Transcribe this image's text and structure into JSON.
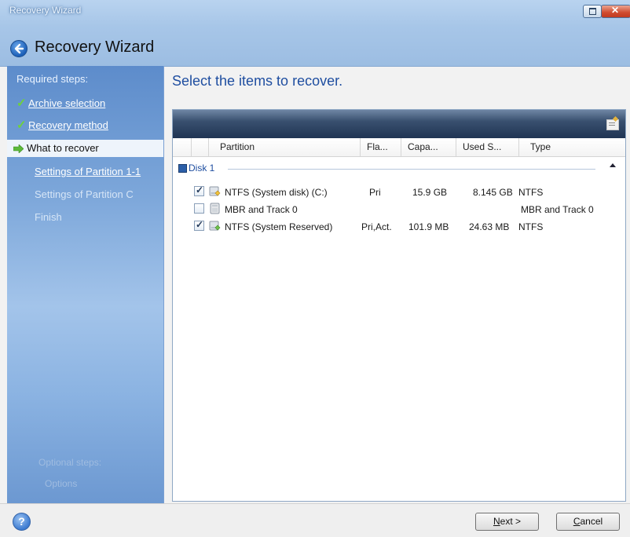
{
  "window": {
    "title": "Recovery Wizard",
    "header_title": "Recovery Wizard",
    "accent": "#1f4ea0"
  },
  "sidebar": {
    "heading": "Required steps:",
    "steps": [
      {
        "label": "Archive selection",
        "state": "done"
      },
      {
        "label": "Recovery method",
        "state": "done"
      },
      {
        "label": "What to recover",
        "state": "current"
      },
      {
        "label": "Settings of Partition 1-1",
        "state": "next"
      },
      {
        "label": "Settings of Partition C",
        "state": "future"
      },
      {
        "label": "Finish",
        "state": "future"
      }
    ],
    "faded_heading": "Optional steps:",
    "faded_item": "Options"
  },
  "main": {
    "heading": "Select the items to recover.",
    "columns": [
      "Partition",
      "Fla...",
      "Capa...",
      "Used S...",
      "Type"
    ],
    "disk_label": "Disk 1",
    "rows": [
      {
        "name": "NTFS (System disk) (C:)",
        "flags": "Pri",
        "capacity": "15.9 GB",
        "used": "8.145 GB",
        "type": "NTFS",
        "checked": true,
        "icon": "partition-icon"
      },
      {
        "name": "MBR and Track 0",
        "flags": "",
        "capacity": "",
        "used": "",
        "type": "MBR and Track 0",
        "checked": false,
        "icon": "disk-icon"
      },
      {
        "name": "NTFS (System Reserved)",
        "flags": "Pri,Act.",
        "capacity": "101.9 MB",
        "used": "24.63 MB",
        "type": "NTFS",
        "checked": true,
        "icon": "partition-icon"
      }
    ]
  },
  "footer": {
    "next_label": "Next >",
    "next_mnemonic": "N",
    "next_rest": "ext >",
    "cancel_mnemonic": "C",
    "cancel_rest": "ancel"
  }
}
